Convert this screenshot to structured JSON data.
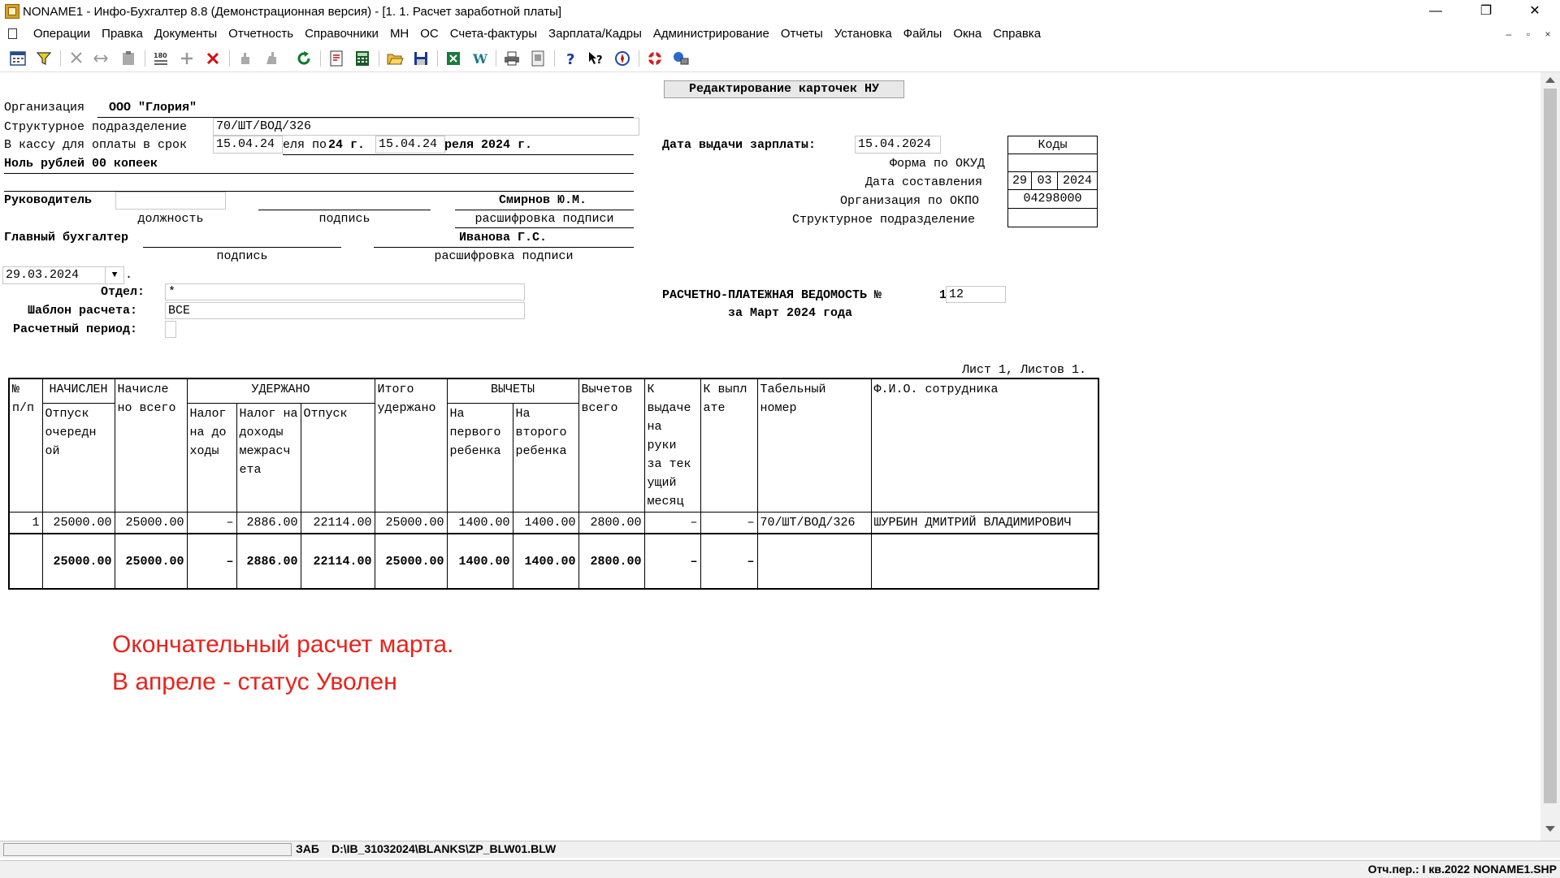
{
  "window": {
    "title": "NONAME1 - Инфо-Бухгалтер 8.8 (Демонстрационная версия) - [1. 1. Расчет заработной платы]",
    "minimize": "—",
    "restore": "❐",
    "close": "✕"
  },
  "menu": {
    "items": [
      "Операции",
      "Правка",
      "Документы",
      "Отчетность",
      "Справочники",
      "МН",
      "ОС",
      "Счета-фактуры",
      "Зарплата/Кадры",
      "Администрирование",
      "Отчеты",
      "Установка",
      "Файлы",
      "Окна",
      "Справка"
    ],
    "mdi_minimize": "–",
    "mdi_restore": "▫",
    "mdi_close": "×"
  },
  "toolbar_icons": [
    "calendar-icon",
    "filter-icon",
    "cut-icon",
    "move-icon",
    "paste-icon",
    "counter-icon",
    "plus-icon",
    "delete-icon",
    "hand-icon",
    "hand2-icon",
    "refresh-icon",
    "report-icon",
    "calculator-icon",
    "open-folder-icon",
    "save-icon",
    "excel-icon",
    "word-icon",
    "print-icon",
    "preview-icon",
    "help-icon",
    "help-context-icon",
    "compass-icon",
    "lifebuoy-icon",
    "network-icon"
  ],
  "form": {
    "edit_button": "Редактирование карточек НУ",
    "org_label": "Организация",
    "org_value": "ООО \"Глория\"",
    "dept_label": "Структурное подразделение",
    "dept_value": "70/ШТ/ВОД/326",
    "kassa_label": "В кассу для оплаты в срок",
    "kassa_from": "15.04.24",
    "kassa_mid": "еля по",
    "kassa_mid2": "24 г.",
    "kassa_to": "15.04.24",
    "kassa_end": "реля 2024 г.",
    "amount_text": "Ноль рублей 00 копеек",
    "head_label": "Руководитель",
    "head_name": "Смирнов Ю.М.",
    "cap_position": "должность",
    "cap_signature": "подпись",
    "cap_decoding": "расшифровка подписи",
    "chief_label": "Главный бухгалтер",
    "chief_name": "Иванова Г.С.",
    "cap_signature2": "подпись",
    "cap_decoding2": "расшифровка подписи",
    "date_value": "29.03.2024",
    "date_suffix": ".",
    "otdel_label": "Отдел:",
    "otdel_value": "*",
    "template_label": "Шаблон расчета:",
    "template_value": "ВСЕ",
    "period_label": "Расчетный период:",
    "pay_date_label": "Дата выдачи зарплаты:",
    "pay_date_value": "15.04.2024",
    "codes_header": "Коды",
    "okud_label": "Форма по ОКУД",
    "date_comp_label": "Дата составления",
    "date_comp_d": "29",
    "date_comp_m": "03",
    "date_comp_y": "2024",
    "okpo_label": "Организация по ОКПО",
    "okpo_value": "04298000",
    "struct_label": "Структурное подразделение",
    "statement_title": "РАСЧЕТНО-ПЛАТЕЖНАЯ ВЕДОМОСТЬ №",
    "statement_num_prefix": "1",
    "statement_num": "12",
    "statement_period": "за Март 2024 года",
    "sheet_info": "Лист 1, Листов 1."
  },
  "table": {
    "h_num": "№ п/п",
    "h_accrued_group": "НАЧИСЛЕН",
    "h_accrued_vac": "Отпуск очередн ой",
    "h_accrued_total": "Начисле но всего",
    "h_withheld_group": "УДЕРЖАНО",
    "h_tax_income": "Налог на до ходы",
    "h_tax_interim": "Налог на доходы межрасч ета",
    "h_vacation": "Отпуск",
    "h_withheld_total": "Итого удержано",
    "h_deduct_group": "ВЫЧЕТЫ",
    "h_first_child": "На первого ребенка",
    "h_second_child": "На второго ребенка",
    "h_deduct_total": "Вычетов всего",
    "h_to_pay": "К выдаче на руки за тек ущий месяц",
    "h_paid": "К выпл ате",
    "h_tab_num": "Табельный номер",
    "h_fio": "Ф.И.О. сотрудника",
    "rows": [
      {
        "n": "1",
        "vac": "25000.00",
        "total": "25000.00",
        "tax": "–",
        "tax2": "2886.00",
        "otp": "22114.00",
        "wh": "25000.00",
        "c1": "1400.00",
        "c2": "1400.00",
        "ded": "2800.00",
        "pay": "–",
        "paid": "–",
        "tab": "70/ШТ/ВОД/326",
        "fio": "ШУРБИН ДМИТРИЙ ВЛАДИМИРОВИЧ"
      }
    ],
    "totals": {
      "vac": "25000.00",
      "total": "25000.00",
      "tax": "–",
      "tax2": "2886.00",
      "otp": "22114.00",
      "wh": "25000.00",
      "c1": "1400.00",
      "c2": "1400.00",
      "ded": "2800.00",
      "pay": "–",
      "paid": "–"
    }
  },
  "note": {
    "line1": "Окончательный расчет марта.",
    "line2": "В апреле - статус Уволен",
    "color": "#e8231c"
  },
  "status": {
    "tag": "ЗАБ",
    "path": "D:\\IB_31032024\\BLANKS\\ZP_BLW01.BLW",
    "period": "Отч.пер.: I кв.2022",
    "file": "NONAME1.SHP"
  }
}
